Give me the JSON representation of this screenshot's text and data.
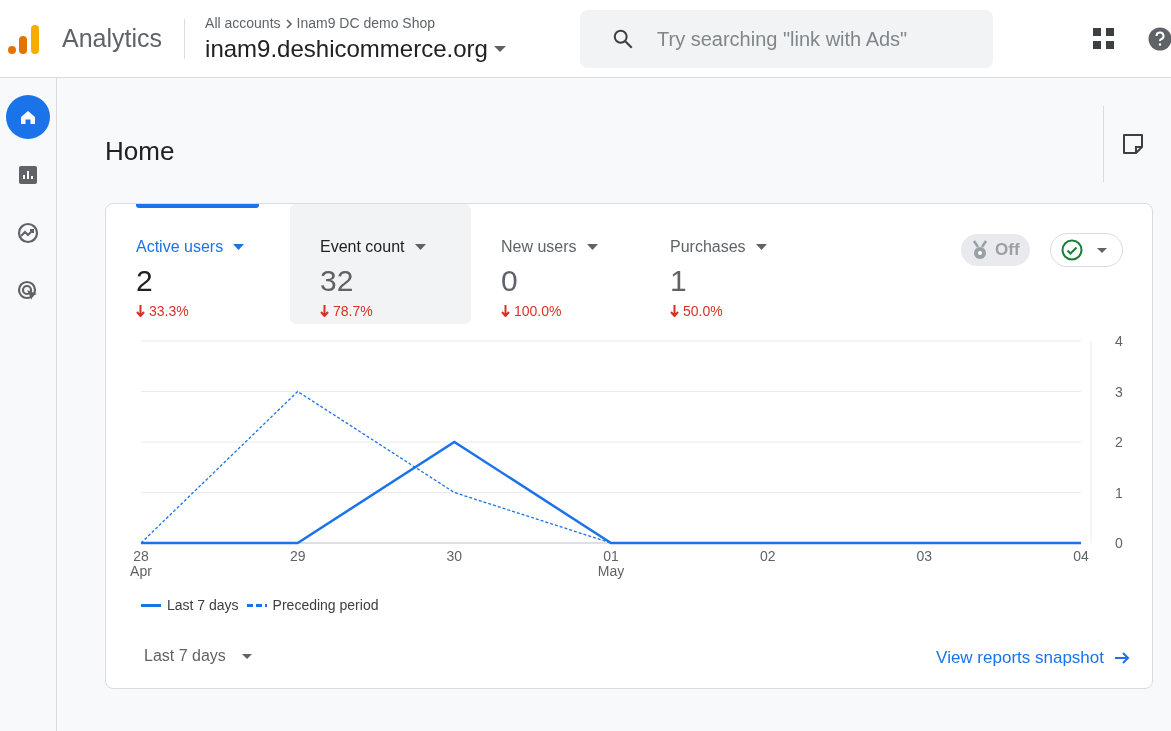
{
  "header": {
    "product": "Analytics",
    "breadcrumb": [
      "All accounts",
      "Inam9 DC demo Shop"
    ],
    "property": "inam9.deshicommerce.org",
    "search": {
      "placeholder": "Try searching \"link with Ads\""
    }
  },
  "sidebar": {
    "items": [
      {
        "selected": true
      },
      {
        "selected": false
      },
      {
        "selected": false
      },
      {
        "selected": false
      }
    ]
  },
  "page": {
    "title": "Home"
  },
  "card": {
    "metrics": [
      {
        "label": "Active users",
        "value": "2",
        "change": "33.3%",
        "selected": true,
        "hovered": false
      },
      {
        "label": "Event count",
        "value": "32",
        "change": "78.7%",
        "selected": false,
        "hovered": true
      },
      {
        "label": "New users",
        "value": "0",
        "change": "100.0%",
        "selected": false,
        "hovered": false
      },
      {
        "label": "Purchases",
        "value": "1",
        "change": "50.0%",
        "selected": false,
        "hovered": false
      }
    ],
    "insights_toggle": {
      "label": "Off",
      "on": false
    },
    "chart_data": {
      "type": "line",
      "grid": true,
      "categories": [
        "28 Apr",
        "29",
        "30",
        "01 May",
        "02",
        "03",
        "04"
      ],
      "ylim": [
        0,
        4
      ],
      "yticks": [
        0,
        1,
        2,
        3,
        4
      ],
      "series": [
        {
          "name": "Last 7 days",
          "color": "#1a73e8",
          "line_style": "solid",
          "values": [
            0,
            0,
            2,
            0,
            0,
            0,
            0
          ]
        },
        {
          "name": "Preceding period",
          "color": "#1a73e8",
          "line_style": "dashed",
          "values": [
            0,
            3,
            1,
            0,
            null,
            null,
            null
          ]
        }
      ]
    },
    "date_range": "Last 7 days",
    "link": "View reports snapshot"
  }
}
